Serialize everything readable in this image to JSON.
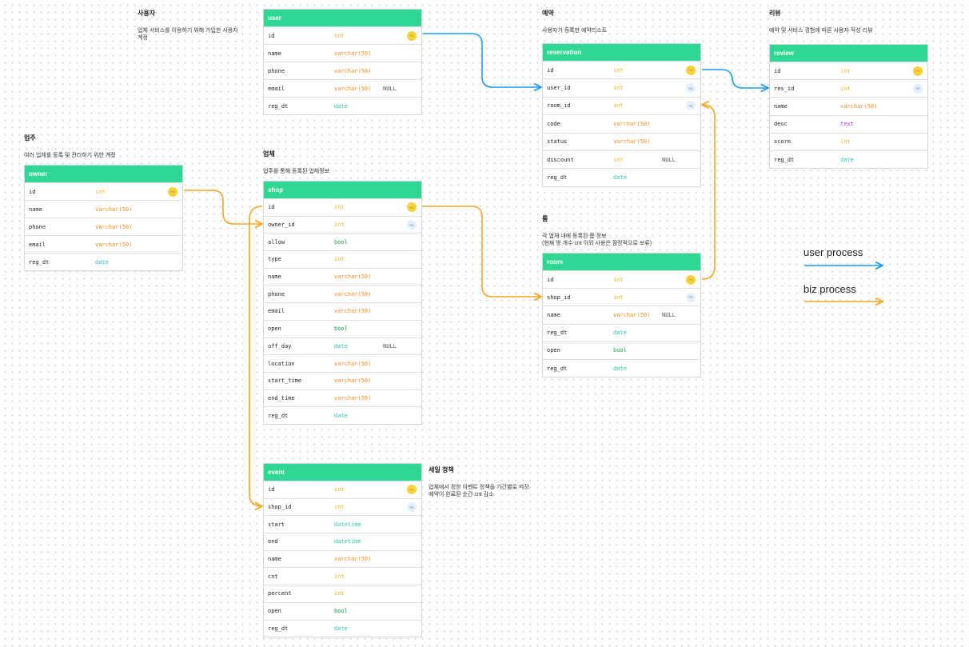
{
  "notes": [
    {
      "id": "user",
      "title": "사용자",
      "desc": "업체 서비스를 이용하기 위해 가입한 사용자\n계정"
    },
    {
      "id": "owner",
      "title": "업주",
      "desc": "여러 업체를 등록 및 관리하기 위한 계정"
    },
    {
      "id": "shop",
      "title": "업체",
      "desc": "업주를 통해 등록된 업체정보"
    },
    {
      "id": "reservation",
      "title": "예약",
      "desc": "사용자가 등록한 예약리스트"
    },
    {
      "id": "room",
      "title": "룸",
      "desc": "각 업체 내에 등록된 룸 정보\n(현재 방 개수 cnt 이외 사용은 잠정적으로 보류)"
    },
    {
      "id": "review",
      "title": "리뷰",
      "desc": "예약 및 서비스 경험에 따른 사용자 작성 리뷰"
    },
    {
      "id": "event",
      "title": "세일 정책",
      "desc": "업체에서 정한 이벤트 정책을 기간별로 저장\n예약이 완료된 순간 cnt 감소"
    }
  ],
  "tables": [
    {
      "name": "user",
      "fields": [
        {
          "name": "id",
          "type": "int",
          "key": "PK"
        },
        {
          "name": "name",
          "type": "varchar(50)"
        },
        {
          "name": "phone",
          "type": "varchar(50)"
        },
        {
          "name": "email",
          "type": "varchar(50)",
          "null": "NULL"
        },
        {
          "name": "reg_dt",
          "type": "date"
        }
      ]
    },
    {
      "name": "owner",
      "fields": [
        {
          "name": "id",
          "type": "int",
          "key": "PK"
        },
        {
          "name": "name",
          "type": "varchar(50)"
        },
        {
          "name": "phone",
          "type": "varchar(50)"
        },
        {
          "name": "email",
          "type": "varchar(50)"
        },
        {
          "name": "reg_dt",
          "type": "date"
        }
      ]
    },
    {
      "name": "shop",
      "fields": [
        {
          "name": "id",
          "type": "int",
          "key": "PK"
        },
        {
          "name": "owner_id",
          "type": "int",
          "key": "FK"
        },
        {
          "name": "allow",
          "type": "bool"
        },
        {
          "name": "type",
          "type": "int"
        },
        {
          "name": "name",
          "type": "varchar(50)"
        },
        {
          "name": "phone",
          "type": "varchar(50)"
        },
        {
          "name": "email",
          "type": "varchar(50)"
        },
        {
          "name": "open",
          "type": "bool"
        },
        {
          "name": "off_day",
          "type": "date",
          "null": "NULL"
        },
        {
          "name": "location",
          "type": "varchar(50)"
        },
        {
          "name": "start_time",
          "type": "varchar(50)"
        },
        {
          "name": "end_time",
          "type": "varchar(50)"
        },
        {
          "name": "reg_dt",
          "type": "date"
        }
      ]
    },
    {
      "name": "reservation",
      "fields": [
        {
          "name": "id",
          "type": "int",
          "key": "PK"
        },
        {
          "name": "user_id",
          "type": "int",
          "key": "FK"
        },
        {
          "name": "room_id",
          "type": "int",
          "key": "FK"
        },
        {
          "name": "code",
          "type": "varchar(50)"
        },
        {
          "name": "status",
          "type": "varchar(50)"
        },
        {
          "name": "discount",
          "type": "int",
          "null": "NULL"
        },
        {
          "name": "reg_dt",
          "type": "date"
        }
      ]
    },
    {
      "name": "room",
      "fields": [
        {
          "name": "id",
          "type": "int",
          "key": "PK"
        },
        {
          "name": "shop_id",
          "type": "int",
          "key": "FK"
        },
        {
          "name": "name",
          "type": "varchar(50)",
          "null": "NULL"
        },
        {
          "name": "reg_dt",
          "type": "date"
        },
        {
          "name": "open",
          "type": "bool"
        },
        {
          "name": "reg_dt",
          "type": "date"
        }
      ]
    },
    {
      "name": "review",
      "fields": [
        {
          "name": "id",
          "type": "int",
          "key": "PK"
        },
        {
          "name": "res_id",
          "type": "int",
          "key": "FK"
        },
        {
          "name": "name",
          "type": "varchar(50)"
        },
        {
          "name": "desc",
          "type": "text"
        },
        {
          "name": "score",
          "type": "int"
        },
        {
          "name": "reg_dt",
          "type": "date"
        }
      ]
    },
    {
      "name": "event",
      "fields": [
        {
          "name": "id",
          "type": "int",
          "key": "PK"
        },
        {
          "name": "shop_id",
          "type": "int",
          "key": "FK"
        },
        {
          "name": "start",
          "type": "datetime"
        },
        {
          "name": "end",
          "type": "datetime"
        },
        {
          "name": "name",
          "type": "varchar(50)"
        },
        {
          "name": "cnt",
          "type": "int"
        },
        {
          "name": "percent",
          "type": "int"
        },
        {
          "name": "open",
          "type": "bool"
        },
        {
          "name": "reg_dt",
          "type": "date"
        }
      ]
    }
  ],
  "legend": [
    {
      "label": "user process",
      "color": "#1d9bf0"
    },
    {
      "label": "biz process",
      "color": "#f5a623"
    }
  ],
  "colors": {
    "header": "#2ed892",
    "user_process": "#1d9bf0",
    "biz_process": "#f5a623"
  }
}
